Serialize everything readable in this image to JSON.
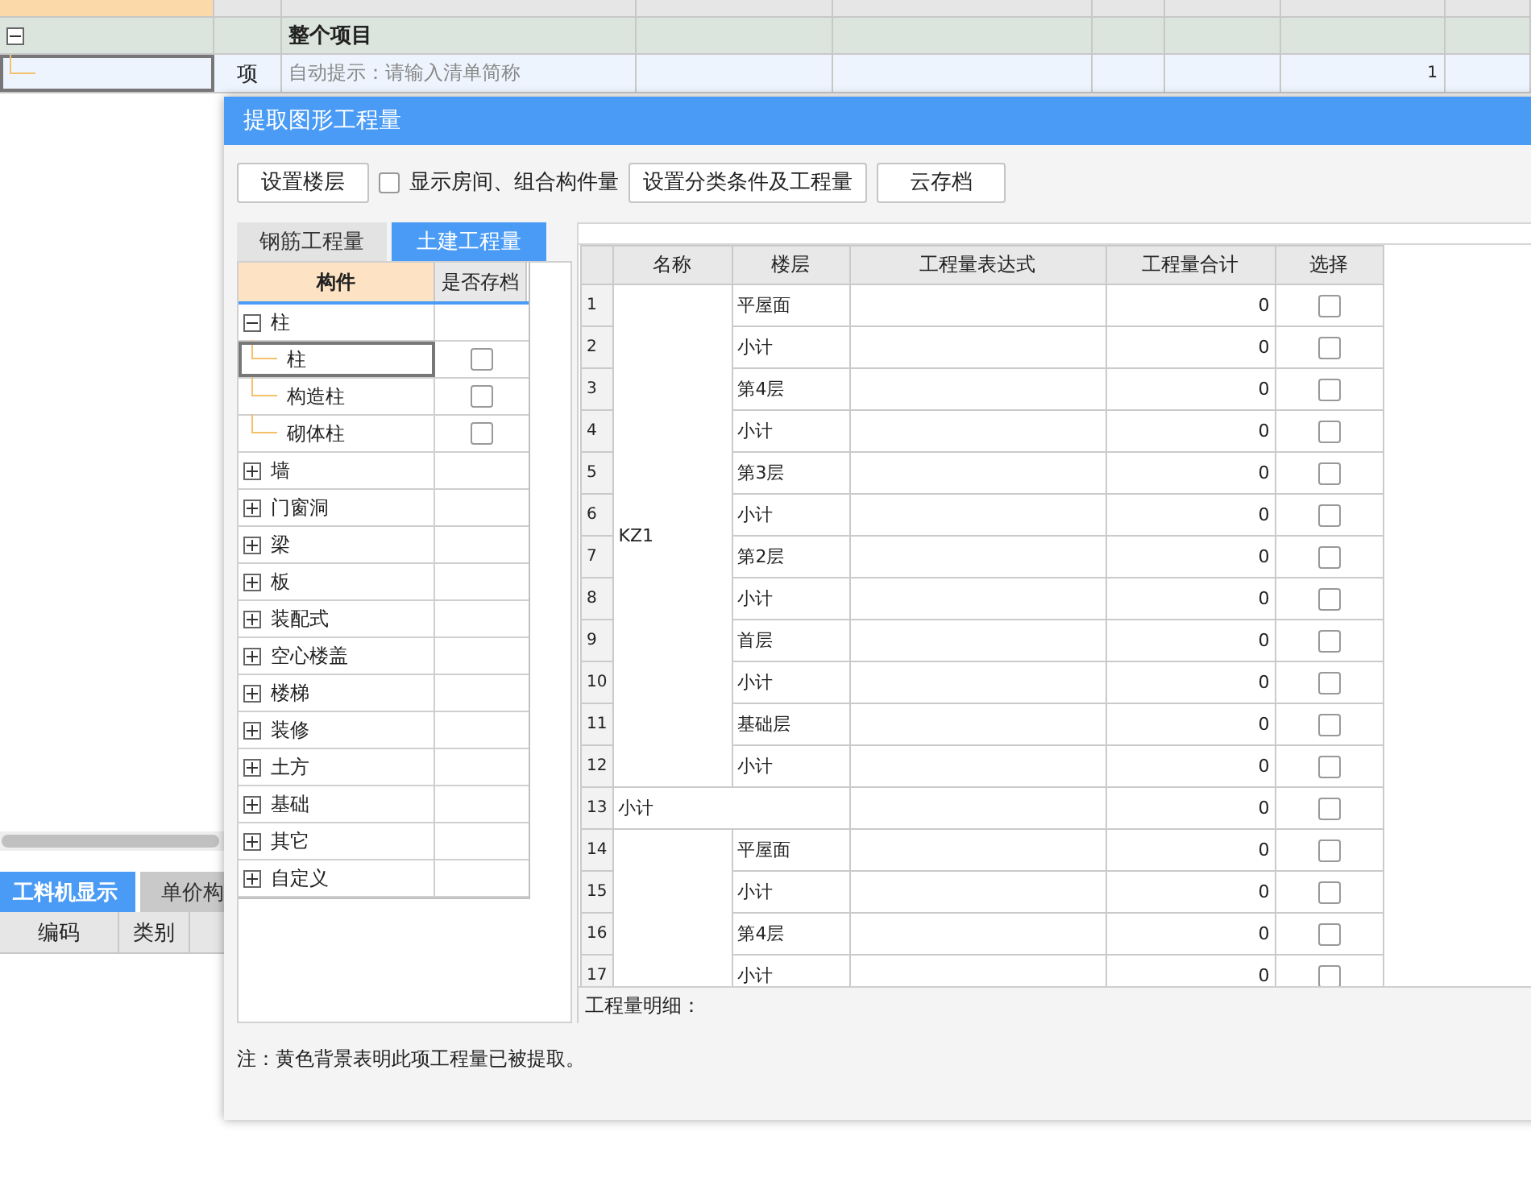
{
  "background": {
    "rows": [
      {
        "kind": "group",
        "expanded": true,
        "title": "整个项目"
      },
      {
        "kind": "item",
        "type": "项",
        "placeholder": "自动提示：请输入清单简称",
        "quantity": "1"
      }
    ],
    "bottom_tabs": [
      {
        "label": "工料机显示",
        "selected": true
      },
      {
        "label": "单价构",
        "selected": false
      }
    ],
    "bottom_columns": [
      "编码",
      "类别"
    ]
  },
  "dialog": {
    "title": "提取图形工程量",
    "toolbar": [
      {
        "kind": "button",
        "label": "设置楼层"
      },
      {
        "kind": "checkbox",
        "label": "显示房间、组合构件量",
        "checked": false
      },
      {
        "kind": "button",
        "label": "设置分类条件及工程量"
      },
      {
        "kind": "button",
        "label": "云存档"
      }
    ],
    "tabs": [
      {
        "label": "钢筋工程量",
        "selected": false
      },
      {
        "label": "土建工程量",
        "selected": true
      }
    ],
    "tree": {
      "columns": [
        "构件",
        "是否存档"
      ],
      "items": [
        {
          "label": "柱",
          "expanded": true,
          "children": [
            {
              "label": "柱",
              "checked": false,
              "selected": true
            },
            {
              "label": "构造柱",
              "checked": false,
              "selected": false
            },
            {
              "label": "砌体柱",
              "checked": false,
              "selected": false
            }
          ]
        },
        {
          "label": "墙",
          "expanded": false
        },
        {
          "label": "门窗洞",
          "expanded": false
        },
        {
          "label": "梁",
          "expanded": false
        },
        {
          "label": "板",
          "expanded": false
        },
        {
          "label": "装配式",
          "expanded": false
        },
        {
          "label": "空心楼盖",
          "expanded": false
        },
        {
          "label": "楼梯",
          "expanded": false
        },
        {
          "label": "装修",
          "expanded": false
        },
        {
          "label": "土方",
          "expanded": false
        },
        {
          "label": "基础",
          "expanded": false
        },
        {
          "label": "其它",
          "expanded": false
        },
        {
          "label": "自定义",
          "expanded": false
        }
      ]
    },
    "grid": {
      "columns": [
        "名称",
        "楼层",
        "工程量表达式",
        "工程量合计",
        "选择"
      ],
      "entries": [
        {
          "kind": "group",
          "name": "KZ1",
          "rows": [
            {
              "no": "1",
              "floor": "平屋面",
              "total": "0",
              "checked": false
            },
            {
              "no": "2",
              "floor": "小计",
              "total": "0",
              "checked": false
            },
            {
              "no": "3",
              "floor": "第4层",
              "total": "0",
              "checked": false
            },
            {
              "no": "4",
              "floor": "小计",
              "total": "0",
              "checked": false
            },
            {
              "no": "5",
              "floor": "第3层",
              "total": "0",
              "checked": false
            },
            {
              "no": "6",
              "floor": "小计",
              "total": "0",
              "checked": false
            },
            {
              "no": "7",
              "floor": "第2层",
              "total": "0",
              "checked": false
            },
            {
              "no": "8",
              "floor": "小计",
              "total": "0",
              "checked": false
            },
            {
              "no": "9",
              "floor": "首层",
              "total": "0",
              "checked": false
            },
            {
              "no": "10",
              "floor": "小计",
              "total": "0",
              "checked": false
            },
            {
              "no": "11",
              "floor": "基础层",
              "total": "0",
              "checked": false
            },
            {
              "no": "12",
              "floor": "小计",
              "total": "0",
              "checked": false
            }
          ]
        },
        {
          "kind": "subtotal",
          "no": "13",
          "label": "小计",
          "total": "0",
          "checked": false
        },
        {
          "kind": "group",
          "rows": [
            {
              "no": "14",
              "floor": "平屋面",
              "total": "0",
              "checked": false
            },
            {
              "no": "15",
              "floor": "小计",
              "total": "0",
              "checked": false
            },
            {
              "no": "16",
              "floor": "第4层",
              "total": "0",
              "checked": false
            },
            {
              "no": "17",
              "floor": "小计",
              "total": "0",
              "checked": false
            }
          ]
        }
      ],
      "detail_label": "工程量明细："
    },
    "note": "注：黄色背景表明此项工程量已被提取。"
  }
}
